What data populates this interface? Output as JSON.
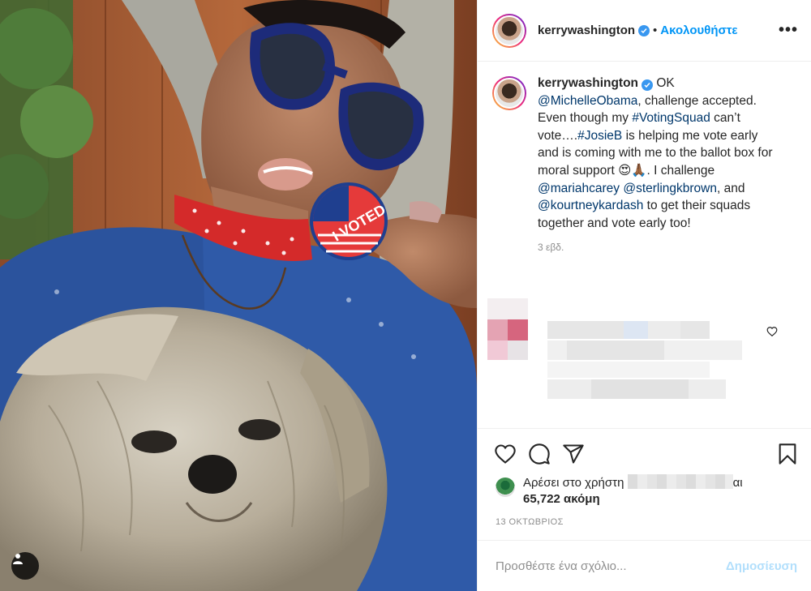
{
  "post": {
    "username": "kerrywashington",
    "follow_label": "Ακολουθήστε",
    "separator": "•",
    "more_label": "•••",
    "caption_parts": {
      "p1": " OK ",
      "m1": "@MichelleObama",
      "p2": ", challenge accepted. Even though my ",
      "h1": "#VotingSquad",
      "p3": " can’t vote….",
      "h2": "#JosieB",
      "p4": " is helping me vote early and is coming with me to the ballot box for moral support 😍🙏🏾. I challenge ",
      "m2": "@mariahcarey",
      "p5": " ",
      "m3": "@sterlingkbrown",
      "p6": ", and ",
      "m4": "@kourtneykardash",
      "p7": " to get their squads together and vote early too!"
    },
    "time_ago": "3 εβδ.",
    "likes_prefix": "Αρέσει στο χρήστη",
    "likes_suffix": "αι",
    "likes_count": "65,722 ακόμη",
    "date": "13 ΟΚΤΩΒΡΙΟΣ",
    "comment_placeholder": "Προσθέστε ένα σχόλιο...",
    "post_button": "Δημοσίευση",
    "sticker_text": "I VOTED"
  },
  "colors": {
    "accent": "#0095f6",
    "verified": "#3897f0",
    "post_button_disabled": "#b2dffc"
  },
  "icons": [
    "verified-icon",
    "more-icon",
    "heart-icon",
    "comment-icon",
    "share-icon",
    "save-icon",
    "tag-user-icon"
  ]
}
